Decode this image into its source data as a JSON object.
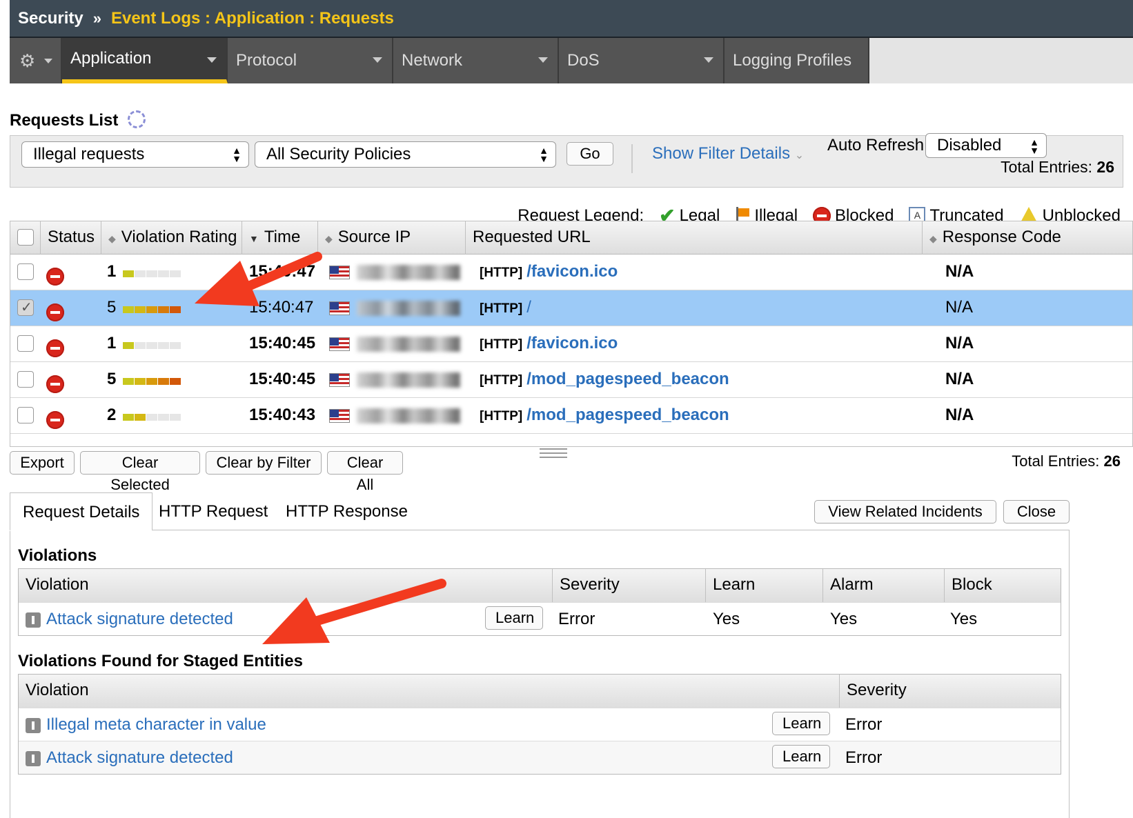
{
  "breadcrumb": {
    "root": "Security",
    "separator": "»",
    "path": "Event Logs : Application : Requests"
  },
  "nav": {
    "tabs": [
      "Application",
      "Protocol",
      "Network",
      "DoS",
      "Logging Profiles"
    ],
    "active": "Application"
  },
  "page": {
    "title": "Requests List"
  },
  "filter": {
    "request_type": "Illegal requests",
    "policy": "All Security Policies",
    "go_label": "Go",
    "show_filter_details": "Show Filter Details",
    "auto_refresh_label": "Auto Refresh",
    "auto_refresh_value": "Disabled",
    "total_label": "Total Entries:",
    "total_value": "26"
  },
  "legend": {
    "title": "Request Legend:",
    "legal": "Legal",
    "illegal": "Illegal",
    "blocked": "Blocked",
    "truncated": "Truncated",
    "unblocked": "Unblocked"
  },
  "table": {
    "headers": {
      "status": "Status",
      "rating": "Violation Rating",
      "time": "Time",
      "source_ip": "Source IP",
      "url": "Requested URL",
      "response": "Response Code"
    },
    "rows": [
      {
        "rating": "1",
        "rating_level": 1,
        "time": "15:40:47",
        "protocol": "[HTTP]",
        "url": "/favicon.ico",
        "response": "N/A",
        "selected": false,
        "bold": true
      },
      {
        "rating": "5",
        "rating_level": 5,
        "time": "15:40:47",
        "protocol": "[HTTP]",
        "url": "/",
        "response": "N/A",
        "selected": true,
        "bold": false
      },
      {
        "rating": "1",
        "rating_level": 1,
        "time": "15:40:45",
        "protocol": "[HTTP]",
        "url": "/favicon.ico",
        "response": "N/A",
        "selected": false,
        "bold": true
      },
      {
        "rating": "5",
        "rating_level": 5,
        "time": "15:40:45",
        "protocol": "[HTTP]",
        "url": "/mod_pagespeed_beacon",
        "response": "N/A",
        "selected": false,
        "bold": true
      },
      {
        "rating": "2",
        "rating_level": 2,
        "time": "15:40:43",
        "protocol": "[HTTP]",
        "url": "/mod_pagespeed_beacon",
        "response": "N/A",
        "selected": false,
        "bold": true
      }
    ]
  },
  "actions": {
    "export": "Export",
    "clear_selected": "Clear Selected",
    "clear_by_filter": "Clear by Filter",
    "clear_all": "Clear All",
    "total_label": "Total Entries:",
    "total_value": "26"
  },
  "details": {
    "tabs": [
      "Request Details",
      "HTTP Request",
      "HTTP Response"
    ],
    "view_related": "View Related Incidents",
    "close": "Close",
    "violations_title": "Violations",
    "violations_headers": [
      "Violation",
      "Severity",
      "Learn",
      "Alarm",
      "Block"
    ],
    "violations": [
      {
        "name": "Attack signature detected",
        "learn_btn": "Learn",
        "severity": "Error",
        "learn": "Yes",
        "alarm": "Yes",
        "block": "Yes"
      }
    ],
    "staged_title": "Violations Found for Staged Entities",
    "staged_headers": [
      "Violation",
      "Severity"
    ],
    "staged": [
      {
        "name": "Illegal meta character in value",
        "learn_btn": "Learn",
        "severity": "Error"
      },
      {
        "name": "Attack signature detected",
        "learn_btn": "Learn",
        "severity": "Error"
      }
    ]
  },
  "colors": {
    "accent": "#f5c518",
    "link": "#2a6ebb",
    "selected_row": "#9ccaf7",
    "blocked": "#d9261c",
    "annotation_arrow": "#f23a1f"
  }
}
